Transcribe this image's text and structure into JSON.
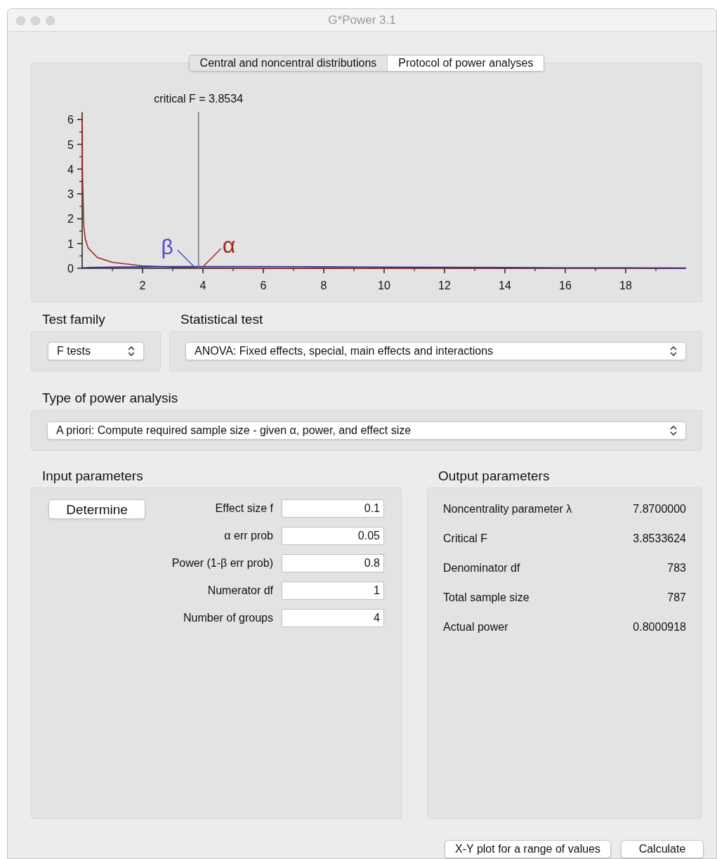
{
  "window": {
    "title": "G*Power 3.1"
  },
  "tabs": [
    {
      "label": "Central and noncentral distributions",
      "selected": true
    },
    {
      "label": "Protocol of power analyses",
      "selected": false
    }
  ],
  "chart": {
    "chart_data": {
      "type": "line",
      "x": [
        0.004,
        0.01,
        0.05,
        0.1,
        0.2,
        0.5,
        1,
        2,
        3,
        4,
        6,
        8,
        10,
        12,
        14,
        16,
        18,
        20
      ],
      "series": [
        {
          "color": "#a0281a",
          "values": [
            6.2,
            3.95,
            1.74,
            1.2,
            0.81,
            0.44,
            0.24,
            0.1,
            0.05,
            0.02,
            0.01,
            0,
            0,
            0,
            0,
            0,
            0,
            0
          ]
        },
        {
          "color": "#2a2aa8",
          "values": [
            0.1,
            0.03,
            0.02,
            0.02,
            0.03,
            0.04,
            0.05,
            0.06,
            0.07,
            0.07,
            0.07,
            0.06,
            0.05,
            0.04,
            0.03,
            0.02,
            0.02,
            0.01
          ]
        }
      ],
      "xlim": [
        0,
        20
      ],
      "ylim": [
        0,
        6.3
      ],
      "xticks": [
        2,
        4,
        6,
        8,
        10,
        12,
        14,
        16,
        18
      ],
      "yticks": [
        0,
        1,
        2,
        3,
        4,
        5,
        6
      ],
      "ref_lines": [
        {
          "axis": "x",
          "value": 3.8534,
          "label": "critical F = 3.8534"
        }
      ],
      "annotations": [
        "β",
        "α"
      ]
    }
  },
  "test_family": {
    "label": "Test family",
    "value": "F tests"
  },
  "statistical_test": {
    "label": "Statistical test",
    "value": "ANOVA: Fixed effects, special, main effects and interactions"
  },
  "power_analysis": {
    "label": "Type of power analysis",
    "value": "A priori: Compute required sample size - given α, power, and effect size"
  },
  "input_parameters": {
    "title": "Input parameters",
    "button": "Determine",
    "fields": [
      {
        "label": "Effect size f",
        "value": "0.1"
      },
      {
        "label": "α err prob",
        "value": "0.05"
      },
      {
        "label": "Power (1-β err prob)",
        "value": "0.8"
      },
      {
        "label": "Numerator df",
        "value": "1"
      },
      {
        "label": "Number of groups",
        "value": "4"
      }
    ]
  },
  "output_parameters": {
    "title": "Output parameters",
    "rows": [
      {
        "label": "Noncentrality parameter λ",
        "value": "7.8700000"
      },
      {
        "label": "Critical F",
        "value": "3.8533624"
      },
      {
        "label": "Denominator df",
        "value": "783"
      },
      {
        "label": "Total sample size",
        "value": "787"
      },
      {
        "label": "Actual power",
        "value": "0.8000918"
      }
    ]
  },
  "buttons": [
    "X-Y plot for a range of values",
    "Calculate"
  ]
}
